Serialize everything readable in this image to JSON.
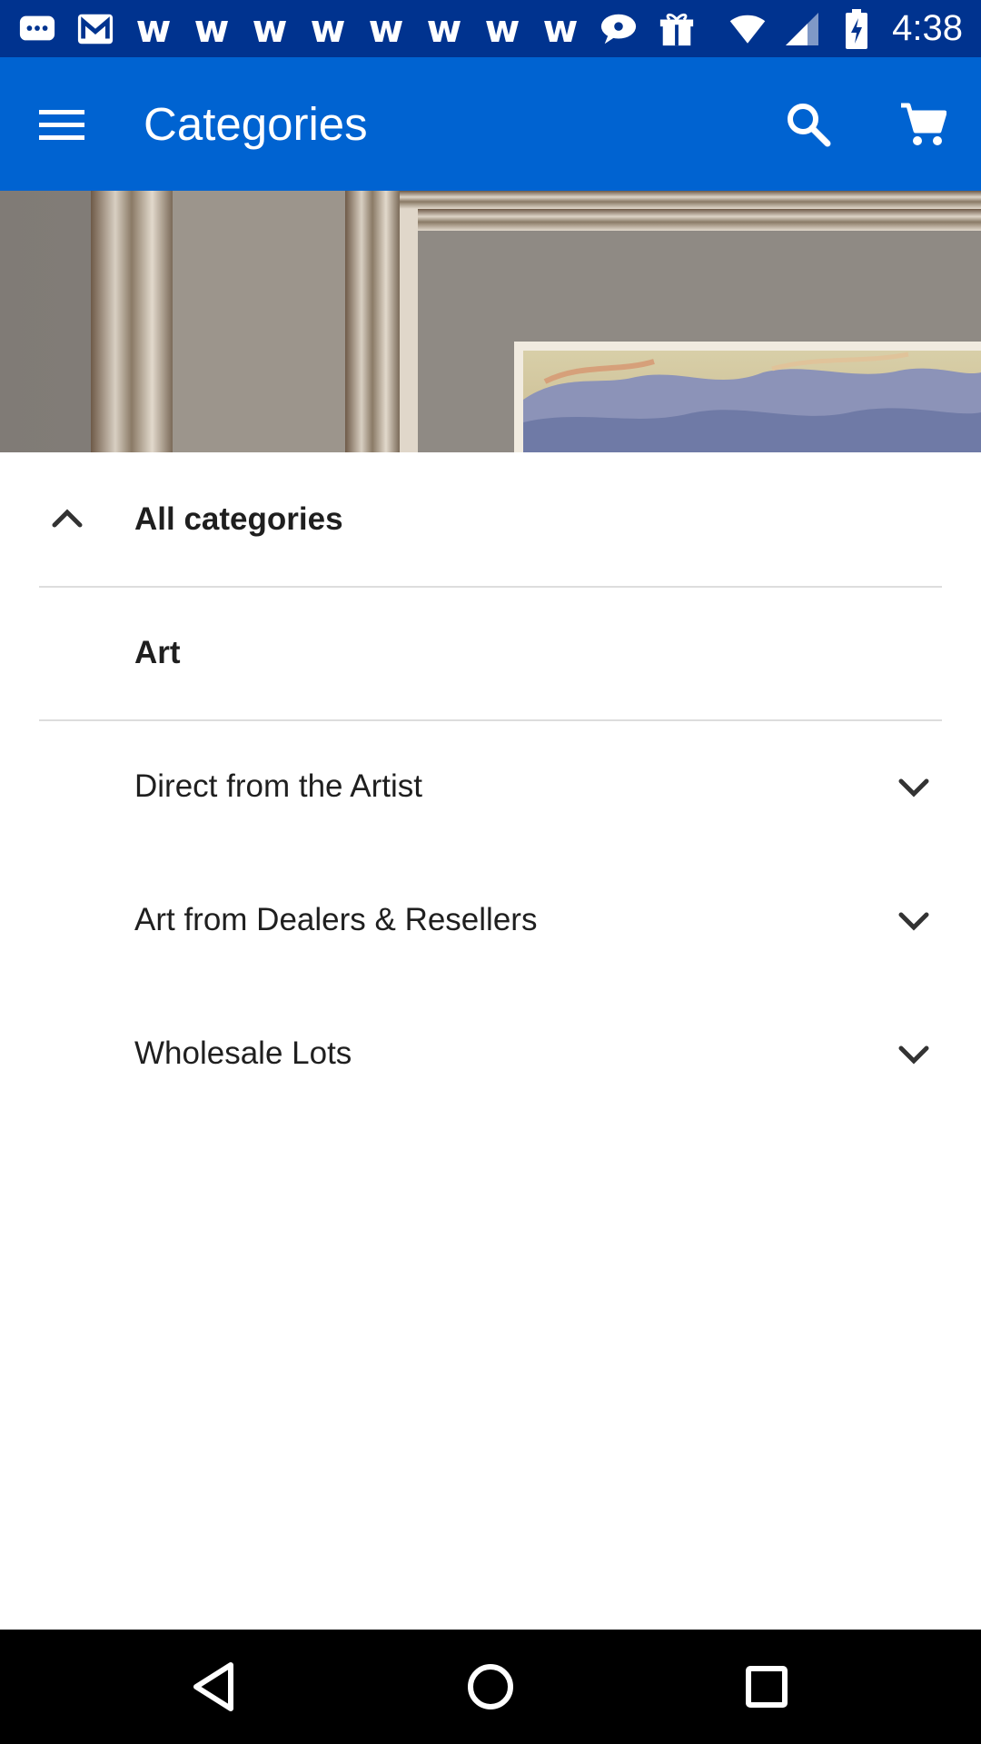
{
  "status_bar": {
    "time": "4:38",
    "notification_icons": [
      "chat-bubble-icon",
      "gmail-icon",
      "w-icon",
      "w-icon",
      "w-icon",
      "w-icon",
      "w-icon",
      "w-icon",
      "w-icon",
      "w-icon",
      "speech-bubble-icon",
      "gift-box-icon"
    ],
    "w_glyph": "w",
    "system_icons": [
      "wifi-icon",
      "cell-signal-icon",
      "battery-charging-icon"
    ]
  },
  "app_bar": {
    "title": "Categories",
    "menu_icon": "menu-icon",
    "search_icon": "search-icon",
    "cart_icon": "cart-icon",
    "background_color": "#0063d1"
  },
  "category_list": {
    "header": {
      "label": "All categories",
      "expanded": true
    },
    "current": {
      "label": "Art"
    },
    "subcategories": [
      {
        "label": "Direct from the Artist"
      },
      {
        "label": "Art from Dealers & Resellers"
      },
      {
        "label": "Wholesale Lots"
      }
    ]
  },
  "nav_bar": {
    "back_icon": "back-triangle-icon",
    "home_icon": "home-circle-icon",
    "recents_icon": "recents-square-icon"
  }
}
